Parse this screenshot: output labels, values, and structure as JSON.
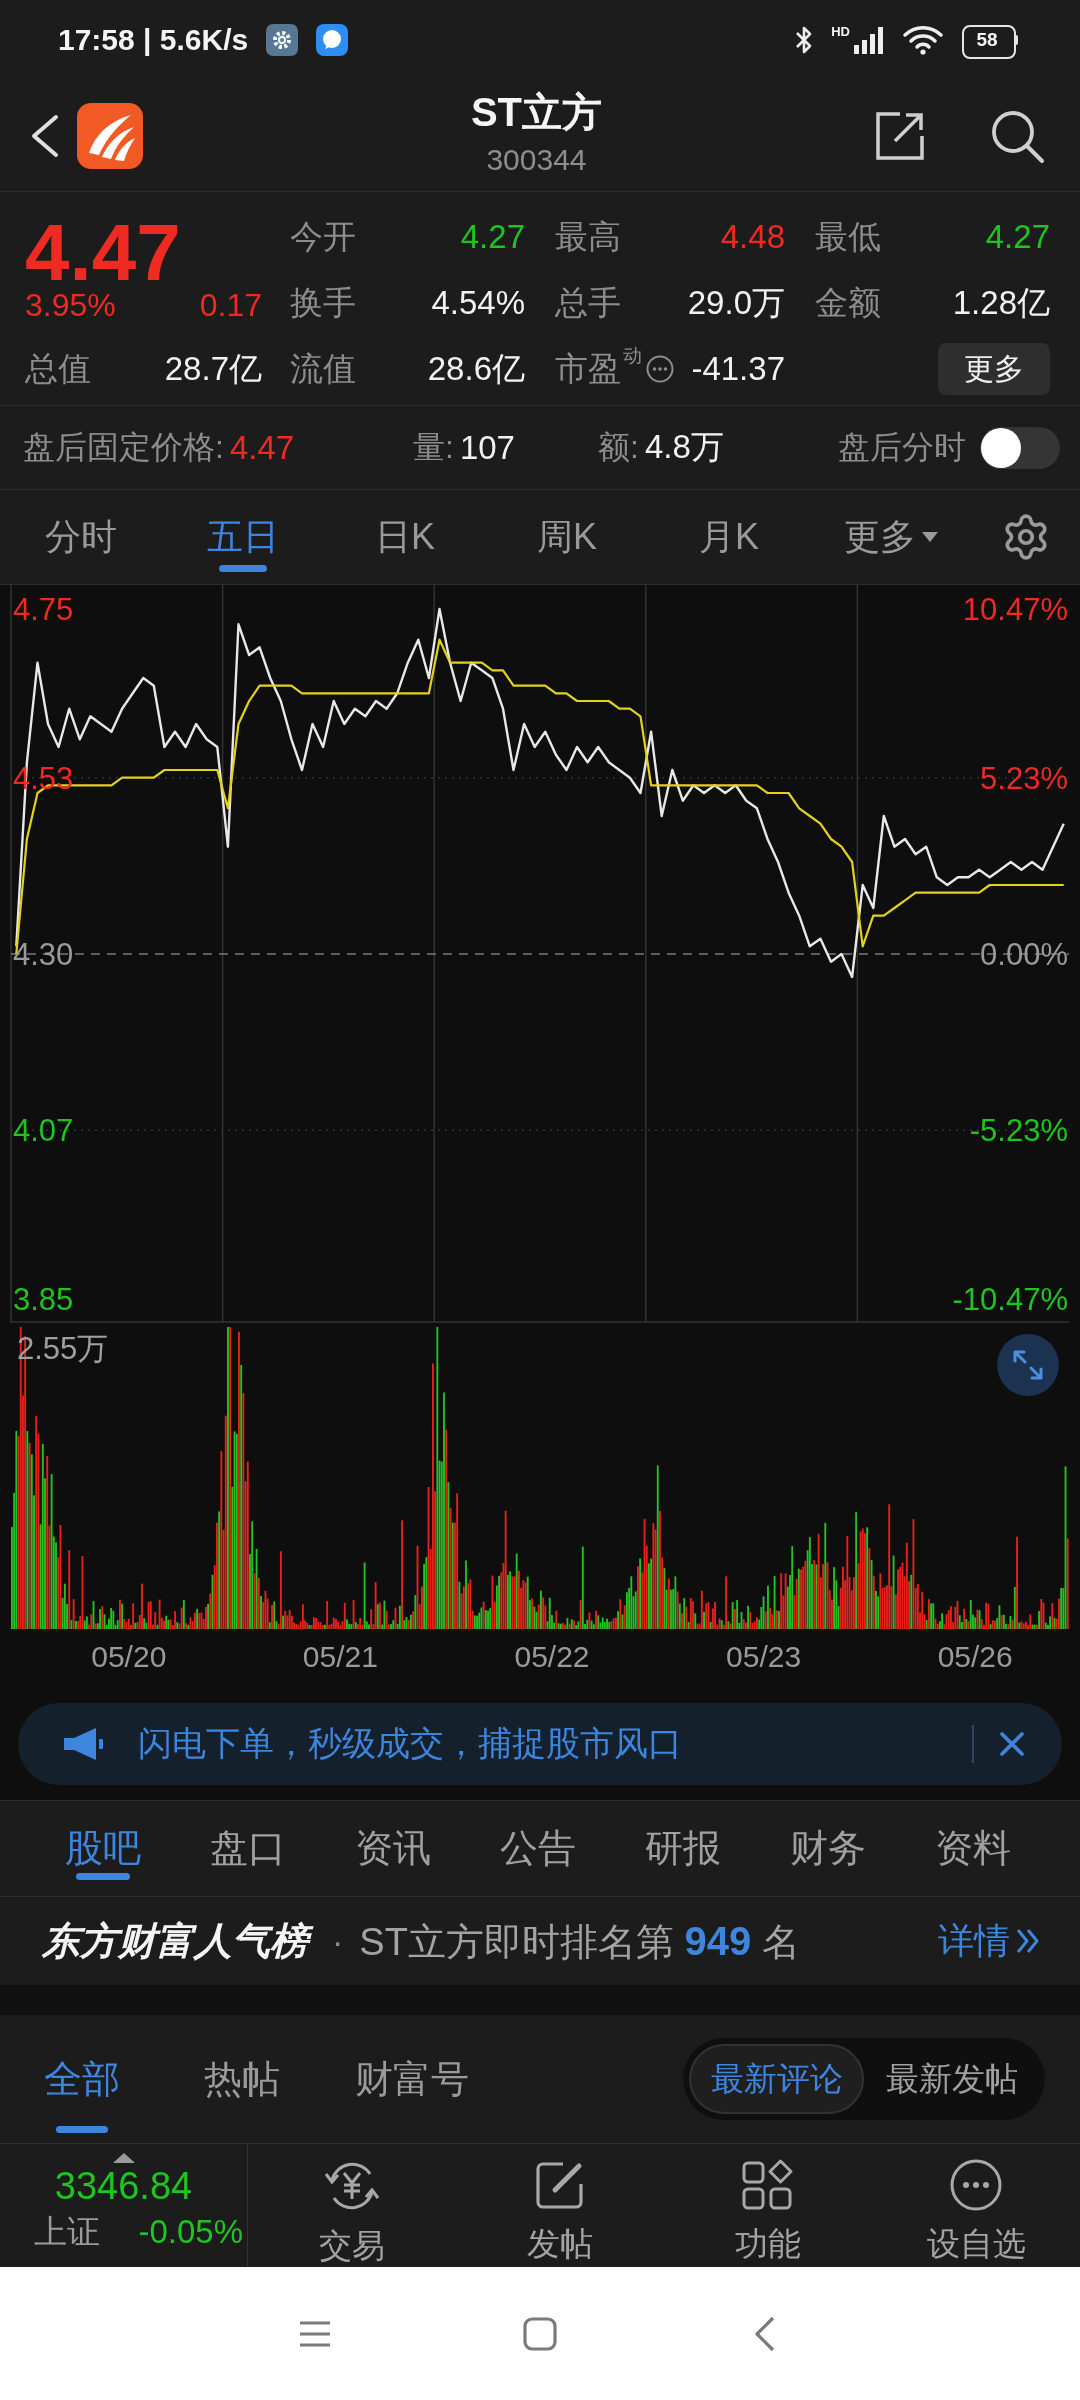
{
  "status_bar": {
    "text": "17:58 | 5.6K/s",
    "network_label": "HD",
    "battery": "58"
  },
  "header": {
    "title": "ST立方",
    "code": "300344"
  },
  "quote": {
    "price": "4.47",
    "change_percent": "3.95%",
    "change": "0.17",
    "color": "#ee2a22",
    "market_value": {
      "label": "总值",
      "value": "28.7亿",
      "color": "#f2f2f2"
    },
    "stats": [
      {
        "kind": "plain",
        "label": "今开",
        "value": "4.27",
        "color": "#1fc51f"
      },
      {
        "kind": "plain",
        "label": "最高",
        "value": "4.48",
        "color": "#ee2a22"
      },
      {
        "kind": "plain",
        "label": "最低",
        "value": "4.27",
        "color": "#1fc51f"
      },
      {
        "kind": "plain",
        "label": "换手",
        "value": "4.54%",
        "color": "#f2f2f2"
      },
      {
        "kind": "plain",
        "label": "总手",
        "value": "29.0万",
        "color": "#f2f2f2"
      },
      {
        "kind": "plain",
        "label": "金额",
        "value": "1.28亿",
        "color": "#f2f2f2"
      },
      {
        "kind": "plain",
        "label": "流值",
        "value": "28.6亿",
        "color": "#f2f2f2"
      },
      {
        "kind": "info",
        "label": "市盈$^{动}$",
        "value": "-41.37",
        "color": "#f2f2f2"
      }
    ],
    "more_button": "更多"
  },
  "after_hours": {
    "items": [
      {
        "label": "盘后固定价格:",
        "value": "4.47",
        "color": "#ee2a22"
      },
      {
        "label": "量:",
        "value": "107",
        "color": "#f2f2f2"
      },
      {
        "label": "额:",
        "value": "4.8万",
        "color": "#f2f2f2"
      }
    ],
    "toggle": {
      "label": "盘后分时",
      "on": false
    }
  },
  "chart": {
    "tabs": [
      {
        "label": "分时",
        "selected": false,
        "kind": "tab"
      },
      {
        "label": "五日",
        "selected": true,
        "kind": "tab"
      },
      {
        "label": "日K",
        "selected": false,
        "kind": "tab"
      },
      {
        "label": "周K",
        "selected": false,
        "kind": "tab"
      },
      {
        "label": "月K",
        "selected": false,
        "kind": "tab"
      },
      {
        "label": "更多",
        "selected": false,
        "kind": "dropdown"
      }
    ],
    "percent_labels": [
      "10.47%",
      "5.23%",
      "0.00%",
      "-5.23%",
      "-10.47%"
    ],
    "chart_data": {
      "type": "line",
      "grid": true,
      "ylim": [
        3.82,
        4.78
      ],
      "yticks": [
        {
          "value": 4.75,
          "label": "4.75"
        },
        {
          "value": 4.53,
          "label": "4.53"
        },
        {
          "value": 4.07,
          "label": "4.07"
        },
        {
          "value": 3.85,
          "label": "3.85"
        }
      ],
      "ref_lines": [
        {
          "axis": "y",
          "value": 4.3,
          "label": "4.30"
        }
      ],
      "series": [
        {
          "color": "#e8e8e8",
          "values": [
            4.31,
            4.55,
            4.68,
            4.6,
            4.57,
            4.62,
            4.58,
            4.61,
            4.6,
            4.59,
            4.62,
            4.64,
            4.66,
            4.65,
            4.57,
            4.59,
            4.57,
            4.6,
            4.58,
            4.57,
            4.44,
            4.73,
            4.69,
            4.7,
            4.66,
            4.63,
            4.58,
            4.54,
            4.6,
            4.57,
            4.63,
            4.6,
            4.62,
            4.61,
            4.63,
            4.62,
            4.64,
            4.68,
            4.71,
            4.66,
            4.75,
            4.68,
            4.63,
            4.68,
            4.67,
            4.66,
            4.62,
            4.54,
            4.6,
            4.57,
            4.59,
            4.56,
            4.54,
            4.57,
            4.55,
            4.57,
            4.55,
            4.54,
            4.53,
            4.51,
            4.59,
            4.48,
            4.54,
            4.5,
            4.52,
            4.51,
            4.52,
            4.51,
            4.52,
            4.5,
            4.49,
            4.45,
            4.42,
            4.38,
            4.35,
            4.31,
            4.32,
            4.29,
            4.3,
            4.27,
            4.39,
            4.36,
            4.48,
            4.44,
            4.45,
            4.43,
            4.44,
            4.4,
            4.39,
            4.4,
            4.4,
            4.41,
            4.4,
            4.41,
            4.42,
            4.41,
            4.42,
            4.41,
            4.44,
            4.47
          ]
        },
        {
          "color": "#e3d21c",
          "values": [
            4.3,
            4.45,
            4.51,
            4.52,
            4.52,
            4.52,
            4.52,
            4.52,
            4.52,
            4.52,
            4.53,
            4.53,
            4.53,
            4.53,
            4.54,
            4.54,
            4.54,
            4.54,
            4.54,
            4.54,
            4.49,
            4.6,
            4.63,
            4.65,
            4.65,
            4.65,
            4.65,
            4.64,
            4.64,
            4.64,
            4.64,
            4.64,
            4.64,
            4.64,
            4.64,
            4.64,
            4.64,
            4.64,
            4.64,
            4.64,
            4.71,
            4.68,
            4.68,
            4.68,
            4.68,
            4.67,
            4.67,
            4.65,
            4.65,
            4.65,
            4.65,
            4.64,
            4.64,
            4.63,
            4.63,
            4.63,
            4.63,
            4.62,
            4.62,
            4.61,
            4.52,
            4.52,
            4.52,
            4.52,
            4.52,
            4.52,
            4.52,
            4.52,
            4.52,
            4.52,
            4.52,
            4.51,
            4.51,
            4.51,
            4.49,
            4.48,
            4.47,
            4.45,
            4.44,
            4.42,
            4.31,
            4.35,
            4.35,
            4.36,
            4.37,
            4.38,
            4.38,
            4.38,
            4.38,
            4.38,
            4.38,
            4.38,
            4.39,
            4.39,
            4.39,
            4.39,
            4.39,
            4.39,
            4.39,
            4.39
          ]
        }
      ]
    },
    "volume": {
      "max_label": "2.55万"
    },
    "dates": [
      "05/20",
      "05/21",
      "05/22",
      "05/23",
      "05/26"
    ]
  },
  "banner": {
    "text": "闪电下单，秒级成交，捕捉股市风口"
  },
  "sections": [
    {
      "label": "股吧",
      "selected": true
    },
    {
      "label": "盘口",
      "selected": false
    },
    {
      "label": "资讯",
      "selected": false
    },
    {
      "label": "公告",
      "selected": false
    },
    {
      "label": "研报",
      "selected": false
    },
    {
      "label": "财务",
      "selected": false
    },
    {
      "label": "资料",
      "selected": false
    }
  ],
  "popularity": {
    "brand": "东方财富人气榜",
    "separator": "·",
    "text": "ST立方即时排名第 **949** 名",
    "link": "详情"
  },
  "posts": {
    "tabs": [
      {
        "label": "全部",
        "selected": true
      },
      {
        "label": "热帖",
        "selected": false
      },
      {
        "label": "财富号",
        "selected": false
      }
    ],
    "sort_options": [
      {
        "label": "最新评论",
        "selected": true
      },
      {
        "label": "最新发帖",
        "selected": false
      }
    ]
  },
  "bottom_bar": {
    "index": {
      "value": "3346.84",
      "name": "上证",
      "change": "-0.05%",
      "color": "#1fc51f"
    },
    "actions": [
      {
        "label": "交易",
        "kind": "trade"
      },
      {
        "label": "发帖",
        "kind": "post"
      },
      {
        "label": "功能",
        "kind": "apps"
      },
      {
        "label": "设自选",
        "kind": "more"
      }
    ]
  }
}
